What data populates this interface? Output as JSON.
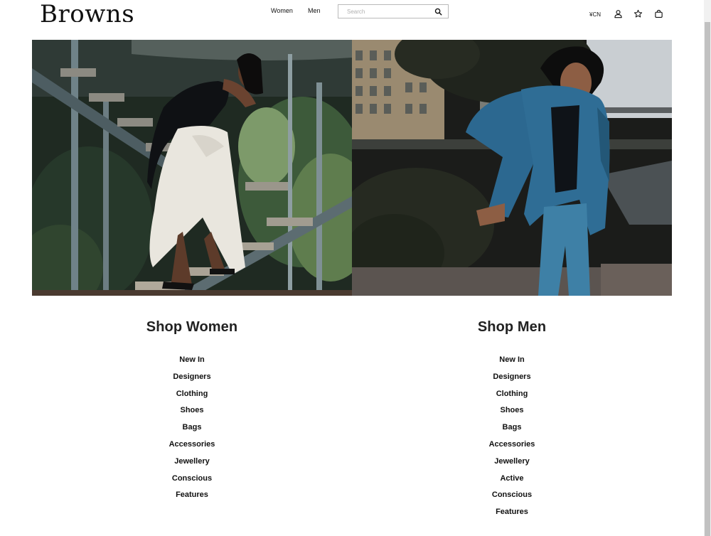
{
  "header": {
    "logo": "Browns",
    "nav": {
      "women": "Women",
      "men": "Men"
    },
    "search": {
      "placeholder": "Search",
      "value": ""
    },
    "currency": "¥CN",
    "icons": [
      "search-icon",
      "account-icon",
      "wishlist-star-icon",
      "shopping-bag-icon"
    ]
  },
  "shop_women": {
    "title": "Shop Women",
    "links": [
      "New In",
      "Designers",
      "Clothing",
      "Shoes",
      "Bags",
      "Accessories",
      "Jewellery",
      "Conscious",
      "Features"
    ]
  },
  "shop_men": {
    "title": "Shop Men",
    "links": [
      "New In",
      "Designers",
      "Clothing",
      "Shoes",
      "Bags",
      "Accessories",
      "Jewellery",
      "Active",
      "Conscious",
      "Features"
    ]
  },
  "colors": {
    "text": "#111111",
    "heading": "#222222",
    "search_border": "#b9b9b9",
    "suit_blue": "#2f6d95"
  }
}
